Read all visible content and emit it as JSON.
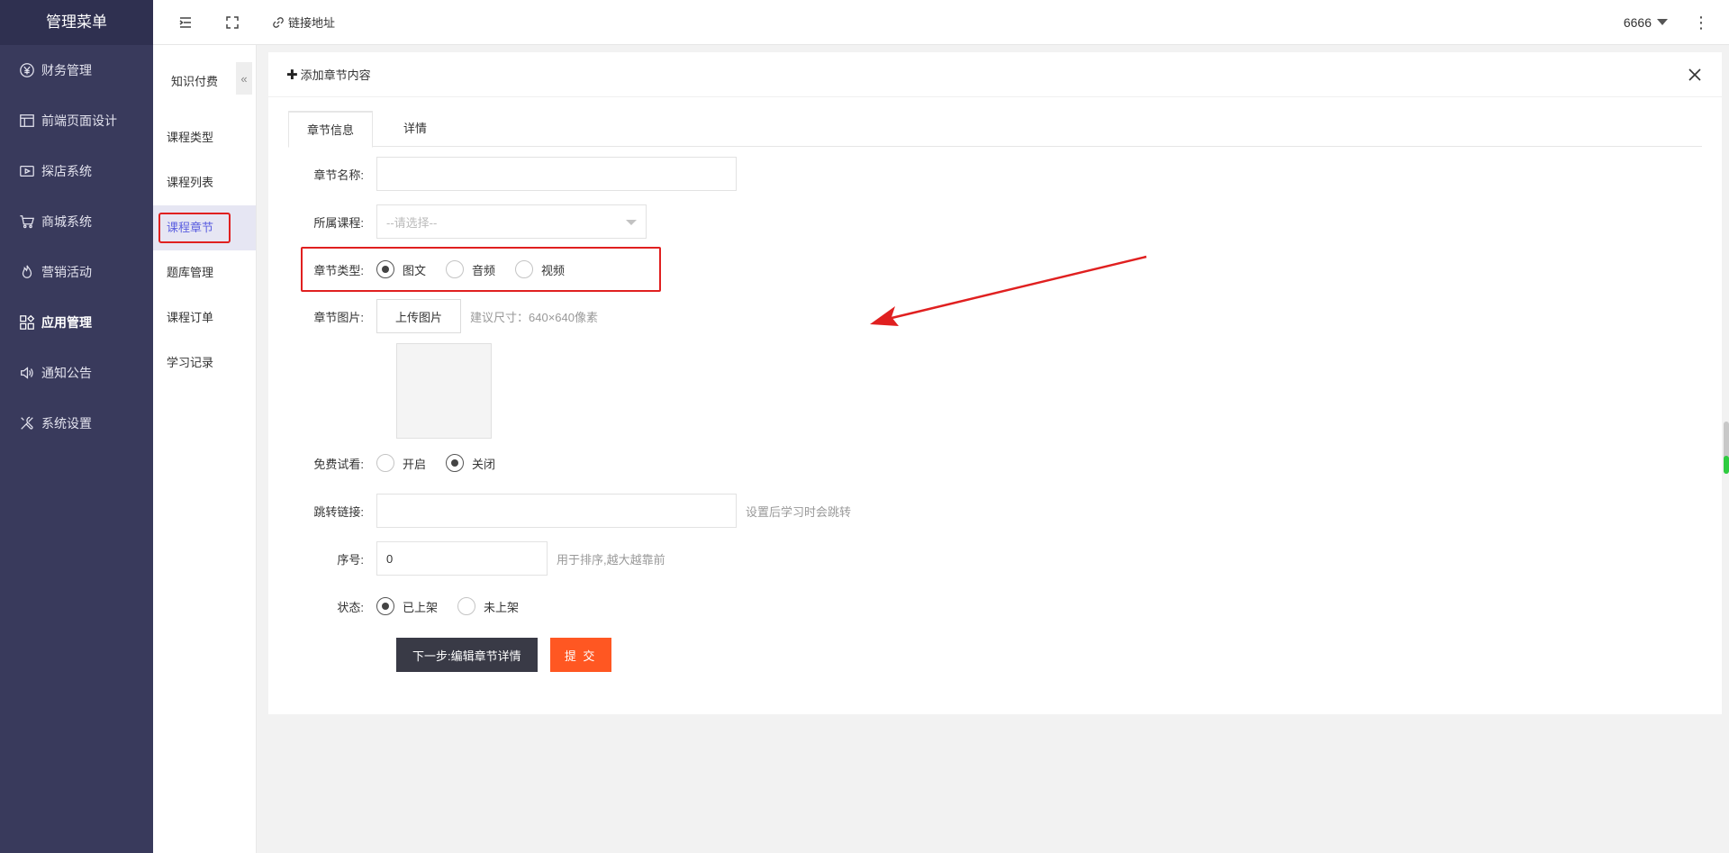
{
  "sidebar": {
    "title": "管理菜单",
    "items": [
      {
        "label": "财务管理",
        "icon": "yen-icon"
      },
      {
        "label": "前端页面设计",
        "icon": "layout-icon"
      },
      {
        "label": "探店系统",
        "icon": "video-icon"
      },
      {
        "label": "商城系统",
        "icon": "cart-icon"
      },
      {
        "label": "营销活动",
        "icon": "fire-icon"
      },
      {
        "label": "应用管理",
        "icon": "apps-icon"
      },
      {
        "label": "通知公告",
        "icon": "speaker-icon"
      },
      {
        "label": "系统设置",
        "icon": "tools-icon"
      }
    ]
  },
  "topbar": {
    "link_label": "链接地址",
    "user": "6666"
  },
  "submenu": {
    "title": "知识付费",
    "collapse": "«",
    "items": [
      "课程类型",
      "课程列表",
      "课程章节",
      "题库管理",
      "课程订单",
      "学习记录"
    ]
  },
  "card": {
    "title": "添加章节内容",
    "tabs": [
      "章节信息",
      "详情"
    ]
  },
  "form": {
    "name_label": "章节名称:",
    "name_value": "",
    "course_label": "所属课程:",
    "course_placeholder": "--请选择--",
    "type_label": "章节类型:",
    "type_options": [
      "图文",
      "音频",
      "视频"
    ],
    "image_label": "章节图片:",
    "upload_btn": "上传图片",
    "image_hint": "建议尺寸：640×640像素",
    "trial_label": "免费试看:",
    "trial_options": [
      "开启",
      "关闭"
    ],
    "link_label": "跳转链接:",
    "link_value": "",
    "link_hint": "设置后学习时会跳转",
    "order_label": "序号:",
    "order_value": "0",
    "order_hint": "用于排序,越大越靠前",
    "status_label": "状态:",
    "status_options": [
      "已上架",
      "未上架"
    ],
    "next_btn": "下一步:编辑章节详情",
    "submit_btn": "提 交"
  },
  "colors": {
    "sidebar_bg": "#393a5c",
    "highlight_red": "#e02020",
    "submit_orange": "#ff5722",
    "next_dark": "#393a46",
    "active_sub": "#5b5fe0"
  }
}
